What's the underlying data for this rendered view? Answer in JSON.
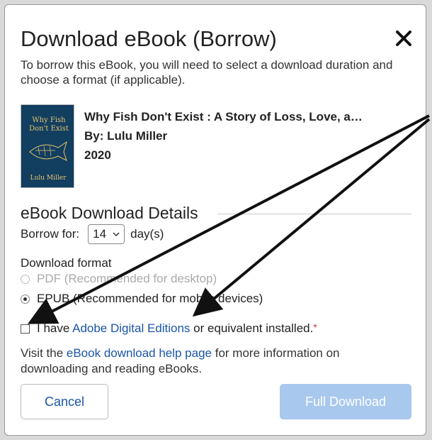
{
  "dialog": {
    "title": "Download eBook (Borrow)",
    "intro": "To borrow this eBook, you will need to select a download duration and choose a format (if applicable)."
  },
  "book": {
    "title": "Why Fish Don't Exist : A Story of Loss, Love, a…",
    "author": "By: Lulu Miller",
    "year": "2020",
    "cover_title": "Why Fish Don't Exist",
    "cover_author": "Lulu Miller"
  },
  "details": {
    "heading": "eBook Download Details",
    "borrow_label": "Borrow for:",
    "borrow_value": "14",
    "borrow_unit": "day(s)",
    "format_label": "Download format",
    "formats": [
      {
        "label": "PDF (Recommended for desktop)",
        "state": "disabled"
      },
      {
        "label": "EPUB (Recommended for mobile devices)",
        "state": "selected"
      }
    ]
  },
  "confirm": {
    "prefix": "I have ",
    "link": "Adobe Digital Editions",
    "suffix": " or equivalent installed.",
    "required_mark": "*"
  },
  "help": {
    "prefix": "Visit the ",
    "link": "eBook download help page",
    "suffix": " for more information on downloading and reading eBooks."
  },
  "buttons": {
    "cancel": "Cancel",
    "full_download": "Full Download"
  },
  "colors": {
    "link": "#1a56a8",
    "primary_disabled": "#a8c8ee",
    "required": "#d23030",
    "cover": "#123e60"
  }
}
